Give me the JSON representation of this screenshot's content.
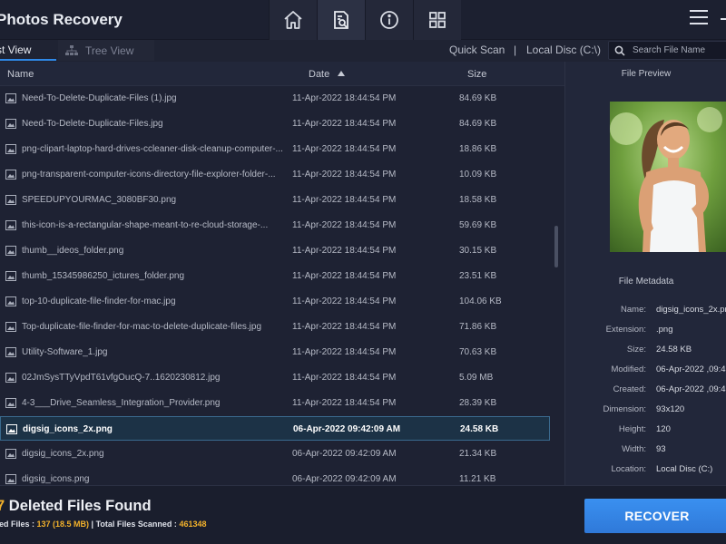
{
  "app": {
    "title": "Photos Recovery"
  },
  "nav": [
    "home-icon",
    "scan-results-icon",
    "info-icon",
    "grid-icon"
  ],
  "views": {
    "list": "st View",
    "tree": "Tree View"
  },
  "scan": {
    "type": "Quick Scan",
    "separator": "|",
    "location": "Local Disc (C:\\)"
  },
  "search": {
    "placeholder": "Search File Name"
  },
  "table": {
    "columns": {
      "name": "Name",
      "date": "Date",
      "size": "Size"
    },
    "rows": [
      {
        "name": "Need-To-Delete-Duplicate-Files (1).jpg",
        "date": "11-Apr-2022 18:44:54 PM",
        "size": "84.69 KB"
      },
      {
        "name": "Need-To-Delete-Duplicate-Files.jpg",
        "date": "11-Apr-2022 18:44:54 PM",
        "size": "84.69 KB"
      },
      {
        "name": "png-clipart-laptop-hard-drives-ccleaner-disk-cleanup-computer-...",
        "date": "11-Apr-2022 18:44:54 PM",
        "size": "18.86 KB"
      },
      {
        "name": "png-transparent-computer-icons-directory-file-explorer-folder-...",
        "date": "11-Apr-2022 18:44:54 PM",
        "size": "10.09 KB"
      },
      {
        "name": "SPEEDUPYOURMAC_3080BF30.png",
        "date": "11-Apr-2022 18:44:54 PM",
        "size": "18.58 KB"
      },
      {
        "name": "this-icon-is-a-rectangular-shape-meant-to-re-cloud-storage-...",
        "date": "11-Apr-2022 18:44:54 PM",
        "size": "59.69 KB"
      },
      {
        "name": "thumb__ideos_folder.png",
        "date": "11-Apr-2022 18:44:54 PM",
        "size": "30.15 KB"
      },
      {
        "name": "thumb_15345986250_ictures_folder.png",
        "date": "11-Apr-2022 18:44:54 PM",
        "size": "23.51 KB"
      },
      {
        "name": "top-10-duplicate-file-finder-for-mac.jpg",
        "date": "11-Apr-2022 18:44:54 PM",
        "size": "104.06 KB"
      },
      {
        "name": "Top-duplicate-file-finder-for-mac-to-delete-duplicate-files.jpg",
        "date": "11-Apr-2022 18:44:54 PM",
        "size": "71.86 KB"
      },
      {
        "name": "Utility-Software_1.jpg",
        "date": "11-Apr-2022 18:44:54 PM",
        "size": "70.63 KB"
      },
      {
        "name": "02JmSysTTyVpdT61vfgOucQ-7..1620230812.jpg",
        "date": "11-Apr-2022 18:44:54 PM",
        "size": "5.09 MB"
      },
      {
        "name": "4-3___Drive_Seamless_Integration_Provider.png",
        "date": "11-Apr-2022 18:44:54 PM",
        "size": "28.39 KB"
      },
      {
        "name": "digsig_icons_2x.png",
        "date": "06-Apr-2022 09:42:09 AM",
        "size": "24.58 KB",
        "selected": true
      },
      {
        "name": "digsig_icons_2x.png",
        "date": "06-Apr-2022 09:42:09 AM",
        "size": "21.34 KB"
      },
      {
        "name": "digsig_icons.png",
        "date": "06-Apr-2022 09:42:09 AM",
        "size": "11.21 KB"
      }
    ]
  },
  "preview": {
    "heading": "File Preview"
  },
  "metadata": {
    "heading": "File Metadata",
    "items": [
      {
        "label": "Name:",
        "value": "digsig_icons_2x.pn"
      },
      {
        "label": "Extension:",
        "value": ".png"
      },
      {
        "label": "Size:",
        "value": "24.58 KB"
      },
      {
        "label": "Modified:",
        "value": "06-Apr-2022 ,09:4"
      },
      {
        "label": "Created:",
        "value": "06-Apr-2022 ,09:4"
      },
      {
        "label": "Dimension:",
        "value": "93x120"
      },
      {
        "label": "Height:",
        "value": "120"
      },
      {
        "label": "Width:",
        "value": "93"
      },
      {
        "label": "Location:",
        "value": "Local Disc (C:)"
      }
    ]
  },
  "footer": {
    "count_glyph": "7",
    "title": "Deleted Files Found",
    "stats_label_1": "ted Files : ",
    "stats_value_1": "137 (18.5 MB)",
    "stats_separator": " | ",
    "stats_label_2": "Total Files Scanned : ",
    "stats_value_2": "461348",
    "recover_label": "RECOVER"
  },
  "colors": {
    "accent": "#f2b12b",
    "primary_button": "#3a90f0",
    "selected_row": "#1c3246",
    "background": "#1e2233"
  }
}
